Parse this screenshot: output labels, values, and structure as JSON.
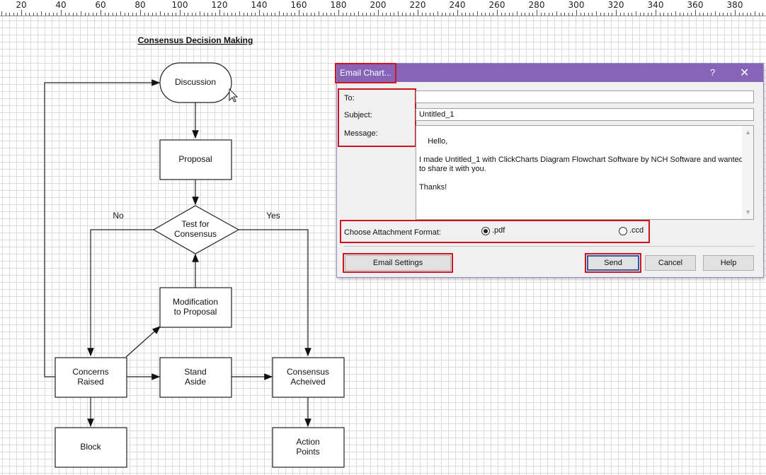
{
  "ruler": {
    "labels": [
      "20",
      "40",
      "60",
      "80",
      "100",
      "120",
      "140",
      "160",
      "180",
      "200",
      "220",
      "240",
      "260",
      "280",
      "300",
      "320",
      "340",
      "360",
      "380"
    ]
  },
  "diagram": {
    "title": "Consensus Decision Making",
    "nodes": {
      "discussion": "Discussion",
      "proposal": "Proposal",
      "test": [
        "Test for",
        "Consensus"
      ],
      "modification": [
        "Modification",
        "to Proposal"
      ],
      "concerns": [
        "Concerns",
        "Raised"
      ],
      "stand_aside": [
        "Stand",
        "Aside"
      ],
      "consensus": [
        "Consensus",
        "Acheived"
      ],
      "block": "Block",
      "action": [
        "Action",
        "Points"
      ]
    },
    "labels": {
      "no": "No",
      "yes": "Yes"
    },
    "colors": {
      "block_text": "#c8282d",
      "consensus_text": "#8a8a8a"
    }
  },
  "dialog": {
    "title": "Email Chart...",
    "help_label": "?",
    "close_label": "✕",
    "to_label": "To:",
    "to_value": "",
    "subject_label": "Subject:",
    "subject_value": "Untitled_1",
    "message_label": "Message:",
    "message_value": "Hello,\n\nI made Untitled_1 with ClickCharts Diagram Flowchart Software by NCH Software and wanted\nto share it with you.\n\nThanks!",
    "attachment_label": "Choose Attachment Format:",
    "formats": [
      {
        "label": ".pdf",
        "selected": true
      },
      {
        "label": ".ccd",
        "selected": false
      }
    ],
    "buttons": {
      "email_settings": "Email Settings",
      "send": "Send",
      "cancel": "Cancel",
      "help": "Help"
    },
    "colors": {
      "titlebar": "#8764b8",
      "highlight": "#d0141e"
    }
  }
}
